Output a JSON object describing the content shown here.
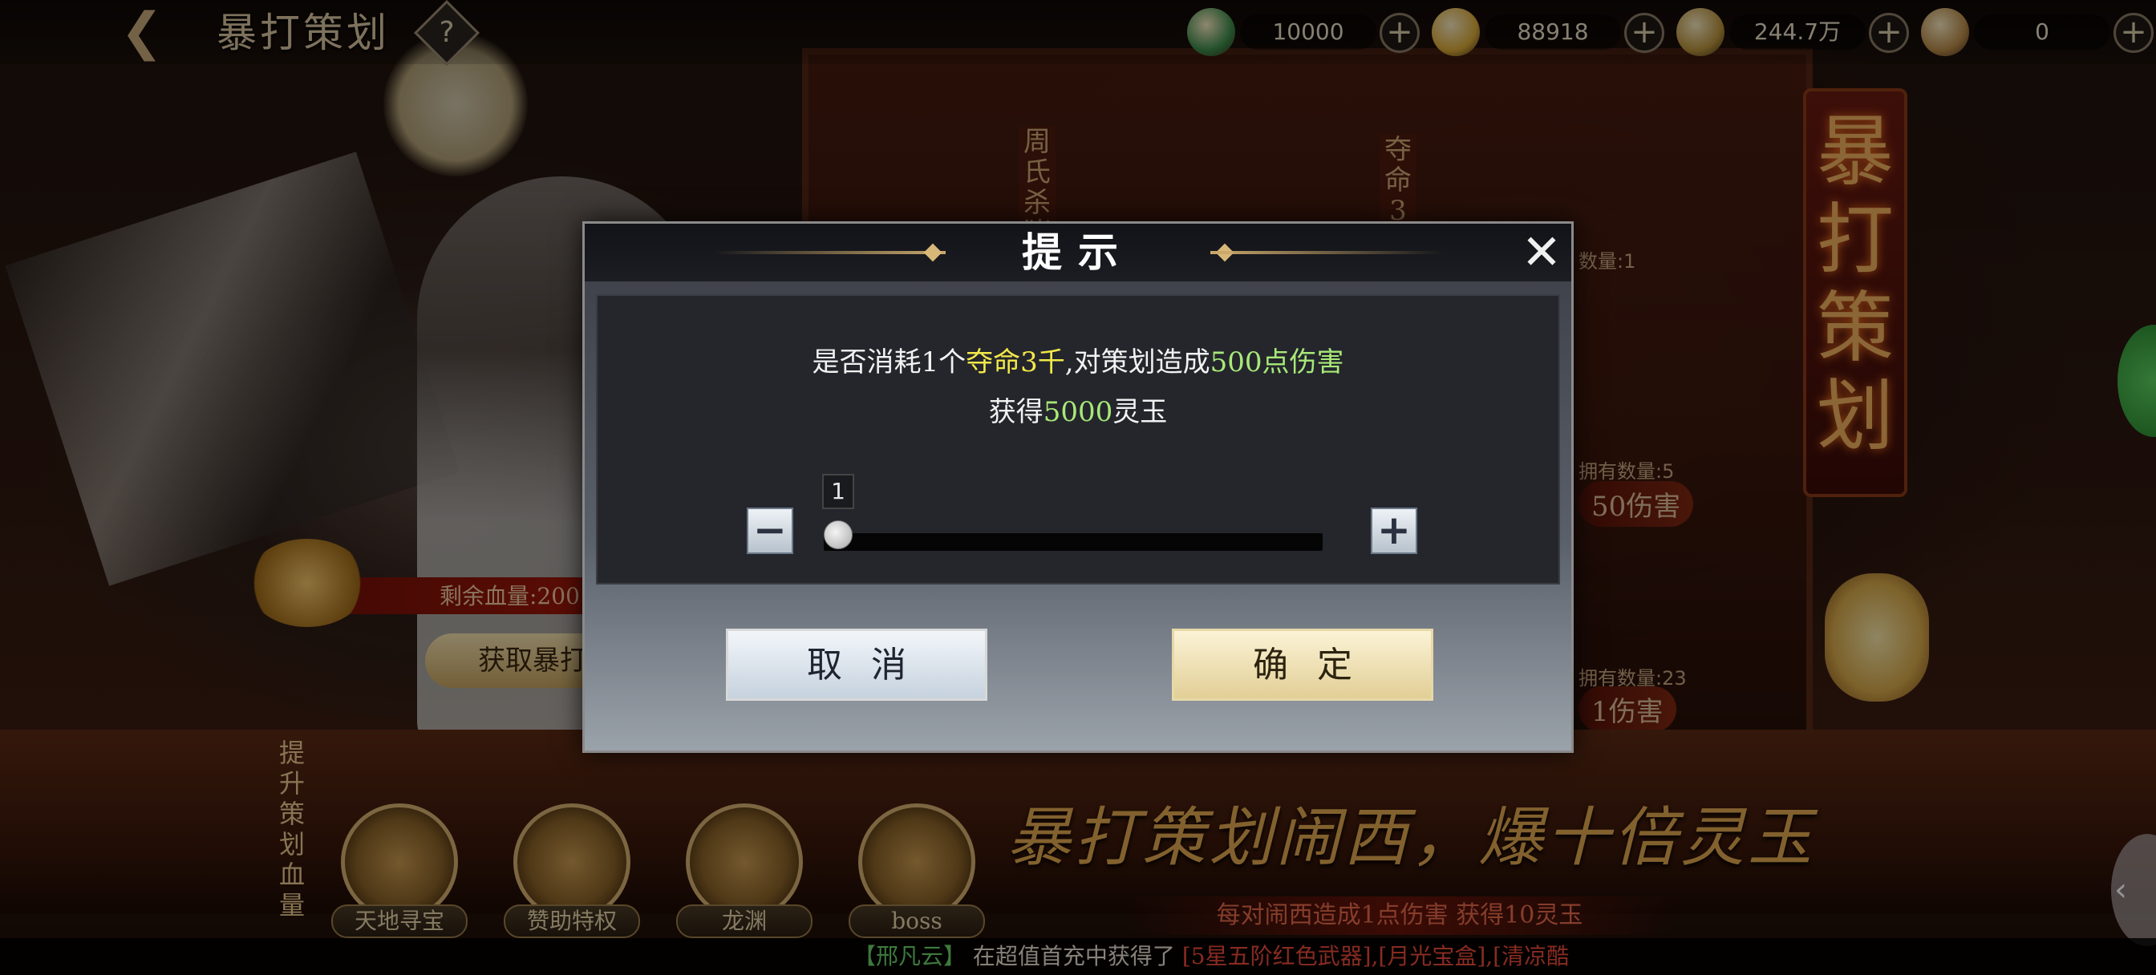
{
  "header": {
    "back_icon": "back-arrow-icon",
    "title": "暴打策划",
    "help_glyph": "?"
  },
  "resources": [
    {
      "name": "jade-icon",
      "value": "10000",
      "plus": "+",
      "color": "#3c8a4a"
    },
    {
      "name": "gold-ingot-icon",
      "value": "88918",
      "plus": "+",
      "color": "#d8a838"
    },
    {
      "name": "copper-coin-icon",
      "value": "244.7万",
      "plus": "+",
      "color": "#b8923c"
    },
    {
      "name": "token-icon",
      "value": "0",
      "plus": "+",
      "color": "#b88a48"
    }
  ],
  "background": {
    "shelf_labels": [
      "周氏杀猪",
      "夺命3"
    ],
    "shelf_counts": [
      "数量:1",
      "拥有数量:5",
      "拥有数量:23"
    ],
    "shelf_tags": [
      "50伤害",
      "1伤害"
    ],
    "banner": "暴打策划",
    "hp_label": "剩余血量:200",
    "get_button": "获取暴打",
    "raise_label": "提升策划血量",
    "functions": [
      "天地寻宝",
      "赞助特权",
      "龙渊",
      "boss"
    ],
    "promo": "暴打策划闹西，爆十倍灵玉",
    "promo_sub": "每对闹西造成1点伤害 获得10灵玉"
  },
  "ticker": {
    "name": "【邢凡云】",
    "text": "在超值首充中获得了",
    "items": "[5星五阶红色武器],[月光宝盒],[清凉酷"
  },
  "dialog": {
    "title": "提示",
    "close_glyph": "✕",
    "message": {
      "part1": "是否消耗1个",
      "item": "夺命3千",
      "part2": ",对策划造成",
      "damage": "500点伤害",
      "reward_prefix": "获得",
      "reward_amount": "5000",
      "reward_suffix": "灵玉"
    },
    "quantity": {
      "value": "1",
      "minus": "−",
      "plus": "+",
      "slider_fraction": 0.0
    },
    "cancel_label": "取消",
    "confirm_label": "确定"
  },
  "colors": {
    "highlight_yellow": "#f2e84a",
    "highlight_green": "#a8e878",
    "ticker_name": "#6ad06a",
    "ticker_text": "#e8e0d0",
    "ticker_items": "#e84a3a"
  }
}
